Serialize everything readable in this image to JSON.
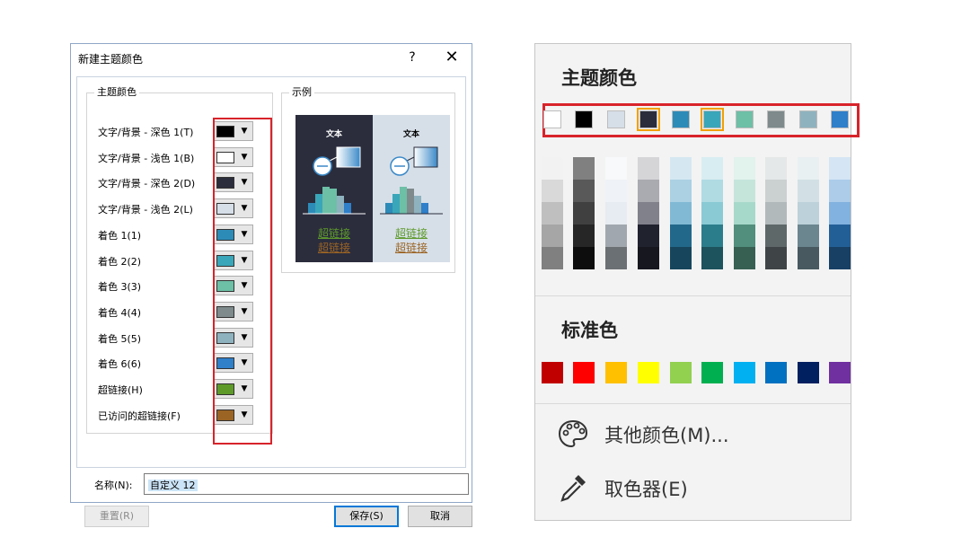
{
  "dialog": {
    "title": "新建主题颜色",
    "help": "?",
    "close": "✕",
    "theme_group_label": "主题颜色",
    "sample_group_label": "示例",
    "rows": [
      {
        "label": "文字/背景 - 深色 1(T)",
        "color": "#000000"
      },
      {
        "label": "文字/背景 - 浅色 1(B)",
        "color": "#ffffff"
      },
      {
        "label": "文字/背景 - 深色 2(D)",
        "color": "#2b2d3d"
      },
      {
        "label": "文字/背景 - 浅色 2(L)",
        "color": "#d6dfe8"
      },
      {
        "label": "着色 1(1)",
        "color": "#2d8bb8"
      },
      {
        "label": "着色 2(2)",
        "color": "#3aa6b9"
      },
      {
        "label": "着色 3(3)",
        "color": "#6dbfa6"
      },
      {
        "label": "着色 4(4)",
        "color": "#7e8a8c"
      },
      {
        "label": "着色 5(5)",
        "color": "#8fb2bf"
      },
      {
        "label": "着色 6(6)",
        "color": "#2f7fc9"
      },
      {
        "label": "超链接(H)",
        "color": "#5e9a2a"
      },
      {
        "label": "已访问的超链接(F)",
        "color": "#9b6424"
      }
    ],
    "sample": {
      "text_label": "文本",
      "link_label": "超链接",
      "visited_link_label": "超链接"
    },
    "name_label": "名称(N):",
    "name_value": "自定义 12",
    "reset_label": "重置(R)",
    "save_label": "保存(S)",
    "cancel_label": "取消"
  },
  "palette": {
    "theme_heading": "主题颜色",
    "standard_heading": "标准色",
    "theme_colors": [
      "#ffffff",
      "#000000",
      "#d6dfe8",
      "#2b2d3d",
      "#2d8bb8",
      "#3aa6b9",
      "#6dbfa6",
      "#7e8a8c",
      "#8fb2bf",
      "#2f7fc9"
    ],
    "standard_colors": [
      "#c00000",
      "#ff0000",
      "#ffc000",
      "#ffff00",
      "#92d050",
      "#00b050",
      "#00b0f0",
      "#0070c0",
      "#002060",
      "#7030a0"
    ],
    "more_colors_label": "其他颜色(M)...",
    "eyedropper_label": "取色器(E)"
  }
}
